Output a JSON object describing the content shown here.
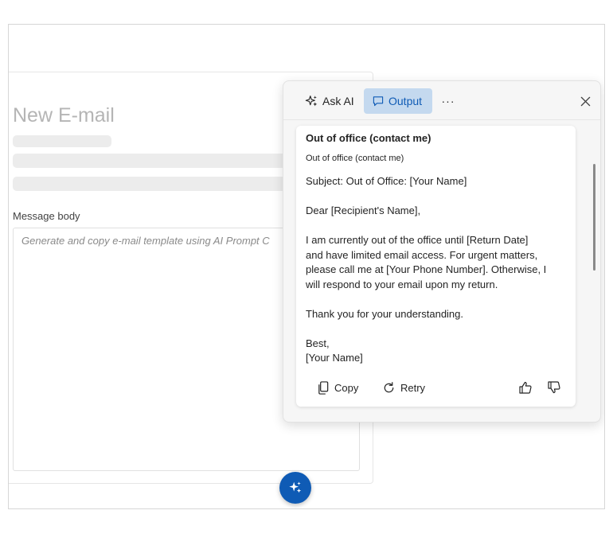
{
  "email": {
    "title": "New E-mail",
    "message_label": "Message body",
    "message_placeholder": "Generate and copy e-mail template using AI Prompt C"
  },
  "panel": {
    "tabs": [
      {
        "label": "Ask AI",
        "icon": "sparkle-icon",
        "active": false
      },
      {
        "label": "Output",
        "icon": "chat-icon",
        "active": true
      }
    ],
    "more_label": "···",
    "output": {
      "title": "Out of office (contact me)",
      "subtitle": "Out of office (contact me)",
      "paragraphs": [
        [
          "Subject: Out of Office: [Your Name]"
        ],
        [
          "Dear [Recipient's Name],"
        ],
        [
          "I am currently out of the office until [Return Date]",
          "and have limited email access. For urgent matters,",
          "please call me at [Your Phone Number]. Otherwise, I",
          "will respond to your email upon my return."
        ],
        [
          "Thank you for your understanding."
        ],
        [
          "Best,",
          "[Your Name]"
        ]
      ],
      "actions": {
        "copy_label": "Copy",
        "retry_label": "Retry"
      }
    }
  },
  "colors": {
    "accent": "#0f5bb5",
    "active_tab_bg": "#c4d9ef"
  }
}
